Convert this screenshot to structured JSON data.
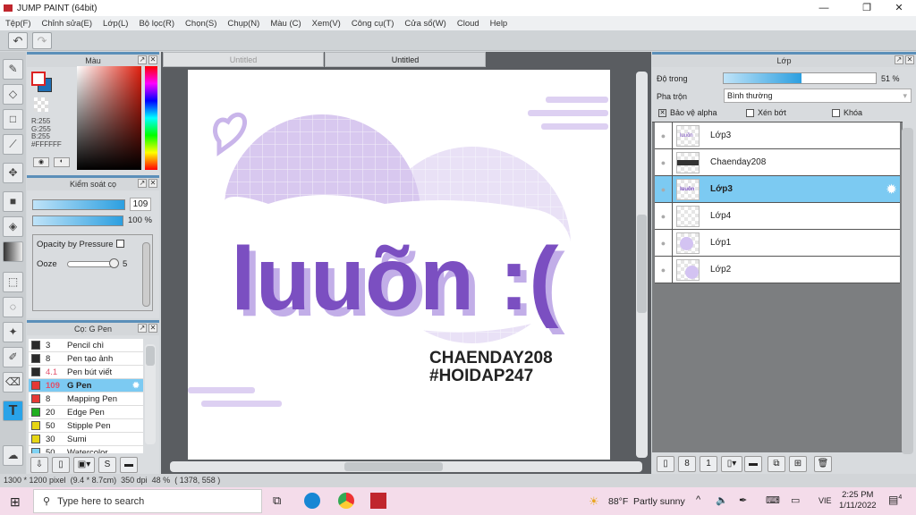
{
  "window": {
    "title": "JUMP PAINT (64bit)",
    "minimize": "—",
    "restore": "❐",
    "close": "✕"
  },
  "menu": [
    "Tệp(F)",
    "Chỉnh sửa(E)",
    "Lớp(L)",
    "Bộ lọc(R)",
    "Chọn(S)",
    "Chụp(N)",
    "Màu (C)",
    "Xem(V)",
    "Công cụ(T)",
    "Cửa sổ(W)",
    "Cloud",
    "Help"
  ],
  "toolbar": {
    "undo": "↶",
    "redo": "↷"
  },
  "color_panel": {
    "title": "Màu",
    "r": "R:255",
    "g": "G:255",
    "b": "B:255",
    "hex": "#FFFFFF",
    "fg": "#ffffff",
    "bg": "#1f6fb5"
  },
  "brush_control": {
    "title": "Kiểm soát cọ",
    "size": "109",
    "opacity": "100 %",
    "opacity_by_pressure": "Opacity by Pressure",
    "ooze_label": "Ooze",
    "ooze_value": "5",
    "ooze_level": 5
  },
  "brush_list": {
    "title": "Cọ: G Pen",
    "items": [
      {
        "size": "3",
        "name": "Pencil chì",
        "color": "#2a2a2a"
      },
      {
        "size": "8",
        "name": "Pen tạo ảnh",
        "color": "#2a2a2a"
      },
      {
        "size": "4.1",
        "name": "Pen bút viết",
        "color": "#2a2a2a"
      },
      {
        "size": "109",
        "name": "G Pen",
        "color": "#e53935",
        "selected": true
      },
      {
        "size": "8",
        "name": "Mapping Pen",
        "color": "#e53935"
      },
      {
        "size": "20",
        "name": "Edge Pen",
        "color": "#1fae1f"
      },
      {
        "size": "50",
        "name": "Stipple Pen",
        "color": "#e6d614"
      },
      {
        "size": "30",
        "name": "Sumi",
        "color": "#e6d614"
      },
      {
        "size": "50",
        "name": "Watercolor",
        "color": "#7fd3f5"
      }
    ]
  },
  "tabs": [
    {
      "label": "Untitled",
      "active": false
    },
    {
      "label": "Untitled",
      "active": true
    }
  ],
  "artwork": {
    "main_text": "luuõn :(",
    "line1": "CHAENDAY208",
    "line2": "#HOIDAP247"
  },
  "layers_panel": {
    "title": "Lớp",
    "opacity_label": "Độ trong",
    "opacity_value": "51 %",
    "opacity_percent": 51,
    "blend_label": "Pha trộn",
    "blend_value": "Bình thường",
    "protect_alpha": "Bảo vệ alpha",
    "clipping": "Xén bớt",
    "lock": "Khóa",
    "layers": [
      {
        "name": "Lớp3"
      },
      {
        "name": "Chaenday208"
      },
      {
        "name": "Lớp3",
        "selected": true
      },
      {
        "name": "Lớp4"
      },
      {
        "name": "Lớp1"
      },
      {
        "name": "Lớp2"
      }
    ]
  },
  "status": {
    "size": "1300 * 1200 pixel",
    "cm": "(9.4 * 8.7cm)",
    "dpi": "350 dpi",
    "zoom": "48 %",
    "coords": "( 1378, 558 )"
  },
  "taskbar": {
    "search_placeholder": "Type here to search",
    "weather": "88°F",
    "weather_desc": "Partly sunny",
    "lang": "VIE",
    "time": "2:25 PM",
    "date": "1/11/2022",
    "notif": "4"
  }
}
